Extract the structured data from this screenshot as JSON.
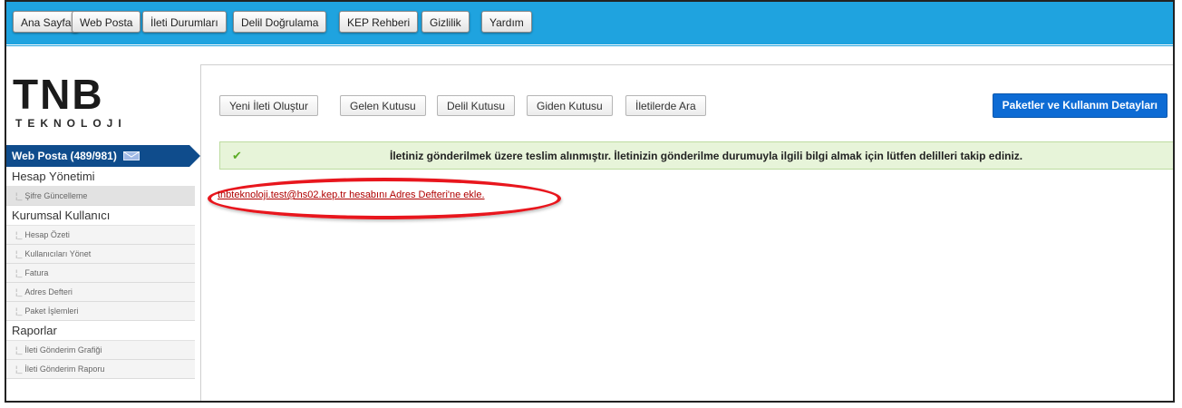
{
  "topnav": [
    "Ana Sayfa",
    "Web Posta",
    "İleti Durumları",
    "Delil Doğrulama",
    "KEP Rehberi",
    "Gizlilik",
    "Yardım"
  ],
  "logo": {
    "main": "TNB",
    "sub": "TEKNOLOJI"
  },
  "sidebar": {
    "header": "Web Posta (489/981)",
    "sections": [
      {
        "label": "Hesap Yönetimi",
        "items": [
          "Şifre Güncelleme"
        ]
      },
      {
        "label": "Kurumsal Kullanıcı",
        "items": [
          "Hesap Özeti",
          "Kullanıcıları Yönet",
          "Fatura",
          "Adres Defteri",
          "Paket İşlemleri"
        ]
      },
      {
        "label": "Raporlar",
        "items": [
          "İleti Gönderim Grafiği",
          "İleti Gönderim Raporu"
        ]
      }
    ]
  },
  "toolbar": [
    "Yeni İleti Oluştur",
    "Gelen Kutusu",
    "Delil Kutusu",
    "Giden Kutusu",
    "İletilerde Ara"
  ],
  "packages_button": "Paketler ve Kullanım Detayları",
  "alert": {
    "icon": "check-icon",
    "message": "İletiniz gönderilmek üzere teslim alınmıştır. İletinizin gönderilme durumuyla ilgili bilgi almak için lütfen delilleri takip ediniz."
  },
  "address_link": "tnbteknoloji.test@hs02.kep.tr hesabını Adres Defteri'ne ekle.",
  "colors": {
    "topbar": "#1fa3df",
    "sidebar_header": "#0f4c8c",
    "primary_button": "#0d6bd4",
    "alert_bg": "#e7f4d9",
    "highlight_ring": "#e8161d"
  }
}
